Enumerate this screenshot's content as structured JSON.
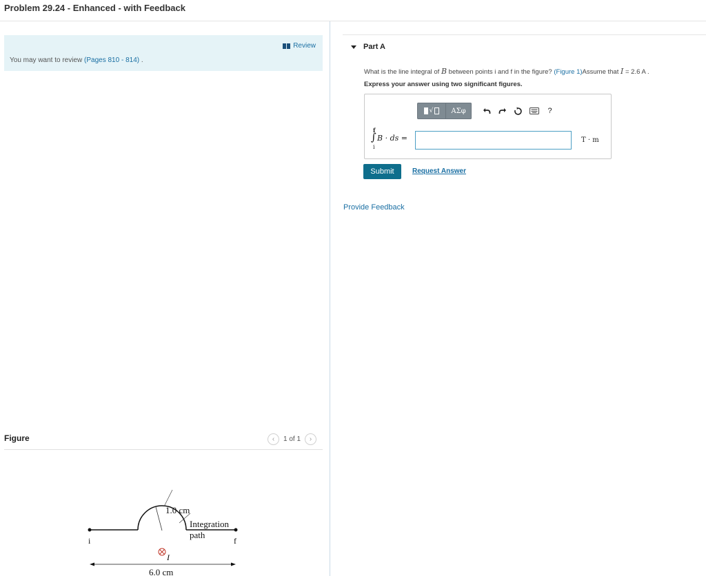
{
  "page": {
    "title": "Problem 29.24 - Enhanced - with Feedback"
  },
  "review": {
    "link_label": "Review",
    "text_prefix": "You may want to review ",
    "pages_link": "(Pages 810 - 814)",
    "text_suffix": " ."
  },
  "figure": {
    "label": "Figure",
    "pager": "1 of 1",
    "prev_icon": "chevron-left-icon",
    "next_icon": "chevron-right-icon",
    "labels": {
      "radius": "1.0 cm",
      "path_line1": "Integration",
      "path_line2": "path",
      "point_i": "i",
      "point_f": "f",
      "current": "I",
      "width": "6.0 cm"
    }
  },
  "part_a": {
    "header": "Part A",
    "question_1": "What is the line integral of ",
    "question_B": "B",
    "question_2": " between points ",
    "question_i": "i",
    "question_3": " and ",
    "question_f": "f",
    "question_4": " in the figure? ",
    "figure_link": "(Figure 1)",
    "question_5": "Assume that ",
    "question_I": "I",
    "question_6": " = 2.6 ",
    "question_A": "A",
    "question_7": " .",
    "instruction": "Express your answer using two significant figures.",
    "toolbar": {
      "templates_icon": "templates-icon",
      "greek_label": "ΑΣφ",
      "undo_icon": "undo-icon",
      "redo_icon": "redo-icon",
      "reset_icon": "reset-icon",
      "keyboard_icon": "keyboard-icon",
      "help_label": "?"
    },
    "integral_upper": "f",
    "integral_lower": "i",
    "integral_expr": "B · ds =",
    "answer_value": "",
    "unit": "T · m",
    "submit_label": "Submit",
    "request_label": "Request Answer"
  },
  "feedback": {
    "label": "Provide Feedback"
  }
}
